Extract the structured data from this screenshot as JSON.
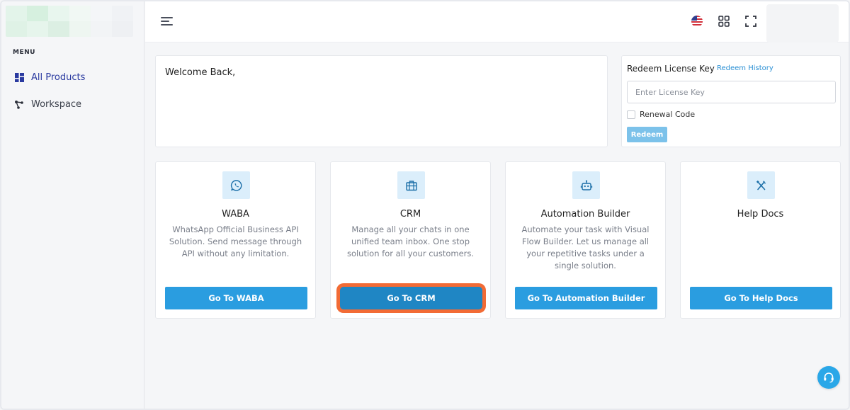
{
  "sidebar": {
    "menu_heading": "MENU",
    "items": [
      {
        "label": "All Products",
        "icon": "grid-icon",
        "active": true
      },
      {
        "label": "Workspace",
        "icon": "nodes-icon",
        "active": false
      }
    ]
  },
  "topbar": {
    "icons": [
      "us-flag-icon",
      "apps-grid-icon",
      "fullscreen-icon"
    ]
  },
  "welcome": {
    "text": "Welcome Back,"
  },
  "redeem": {
    "title": "Redeem License Key",
    "history_link": "Redeem History",
    "input_value": "",
    "input_placeholder": "Enter License Key",
    "renewal_label": "Renewal Code",
    "renewal_checked": false,
    "button_label": "Redeem"
  },
  "products": [
    {
      "title": "WABA",
      "icon": "whatsapp-icon",
      "description": "WhatsApp Official Business API Solution. Send message through API without any limitation.",
      "button": "Go To WABA"
    },
    {
      "title": "CRM",
      "icon": "briefcase-icon",
      "description": "Manage all your chats in one unified team inbox. One stop solution for all your customers.",
      "button": "Go To CRM"
    },
    {
      "title": "Automation Builder",
      "icon": "robot-icon",
      "description": "Automate your task with Visual Flow Builder. Let us manage all your repetitive tasks under a single solution.",
      "button": "Go To Automation Builder"
    },
    {
      "title": "Help Docs",
      "icon": "tools-icon",
      "description": "",
      "button": "Go To Help Docs"
    }
  ],
  "colors": {
    "primary_button": "#2a9de0",
    "highlight_outline": "#f26b35",
    "icon_tile": "#dbeefb",
    "link": "#2a8fd4",
    "active_nav": "#2a3aa0"
  }
}
